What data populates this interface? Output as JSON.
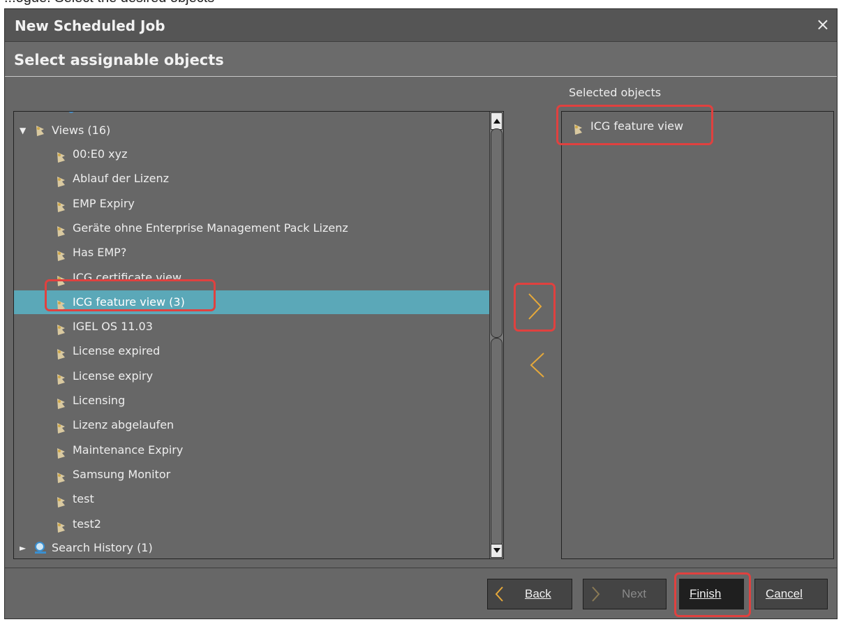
{
  "document_text_fragment": "...ogue. Select the desired objects",
  "dialog": {
    "title": "New Scheduled Job",
    "close_glyph": "×",
    "step_title": "Select assignable objects",
    "selected_label": "Selected objects"
  },
  "tree": {
    "views": {
      "label": "Views (16)",
      "expanded": true,
      "icon": "view-icon"
    },
    "items": [
      {
        "label": "00:E0 xyz"
      },
      {
        "label": "Ablauf der Lizenz"
      },
      {
        "label": "EMP Expiry"
      },
      {
        "label": "Geräte ohne Enterprise Management Pack Lizenz"
      },
      {
        "label": "Has EMP?"
      },
      {
        "label": "ICG certificate view"
      },
      {
        "label": "ICG feature view (3)",
        "selected": true
      },
      {
        "label": "IGEL OS 11.03"
      },
      {
        "label": "License expired"
      },
      {
        "label": "License expiry"
      },
      {
        "label": "Licensing"
      },
      {
        "label": "Lizenz abgelaufen"
      },
      {
        "label": "Maintenance Expiry"
      },
      {
        "label": "Samsung Monitor"
      },
      {
        "label": "test"
      },
      {
        "label": "test2"
      }
    ],
    "search_history": {
      "label": "Search History (1)",
      "expanded": false,
      "icon": "search-icon"
    }
  },
  "selected_objects": [
    {
      "label": "ICG feature view",
      "icon": "view-icon"
    }
  ],
  "buttons": {
    "back": {
      "label": "Back",
      "enabled": true
    },
    "next": {
      "label": "Next",
      "enabled": false
    },
    "finish": {
      "label": "Finish",
      "enabled": true
    },
    "cancel": {
      "label": "Cancel",
      "enabled": true
    }
  },
  "colors": {
    "highlight": "#e0413f",
    "selection": "#5ba8b8",
    "arrow": "#e6a93a"
  }
}
